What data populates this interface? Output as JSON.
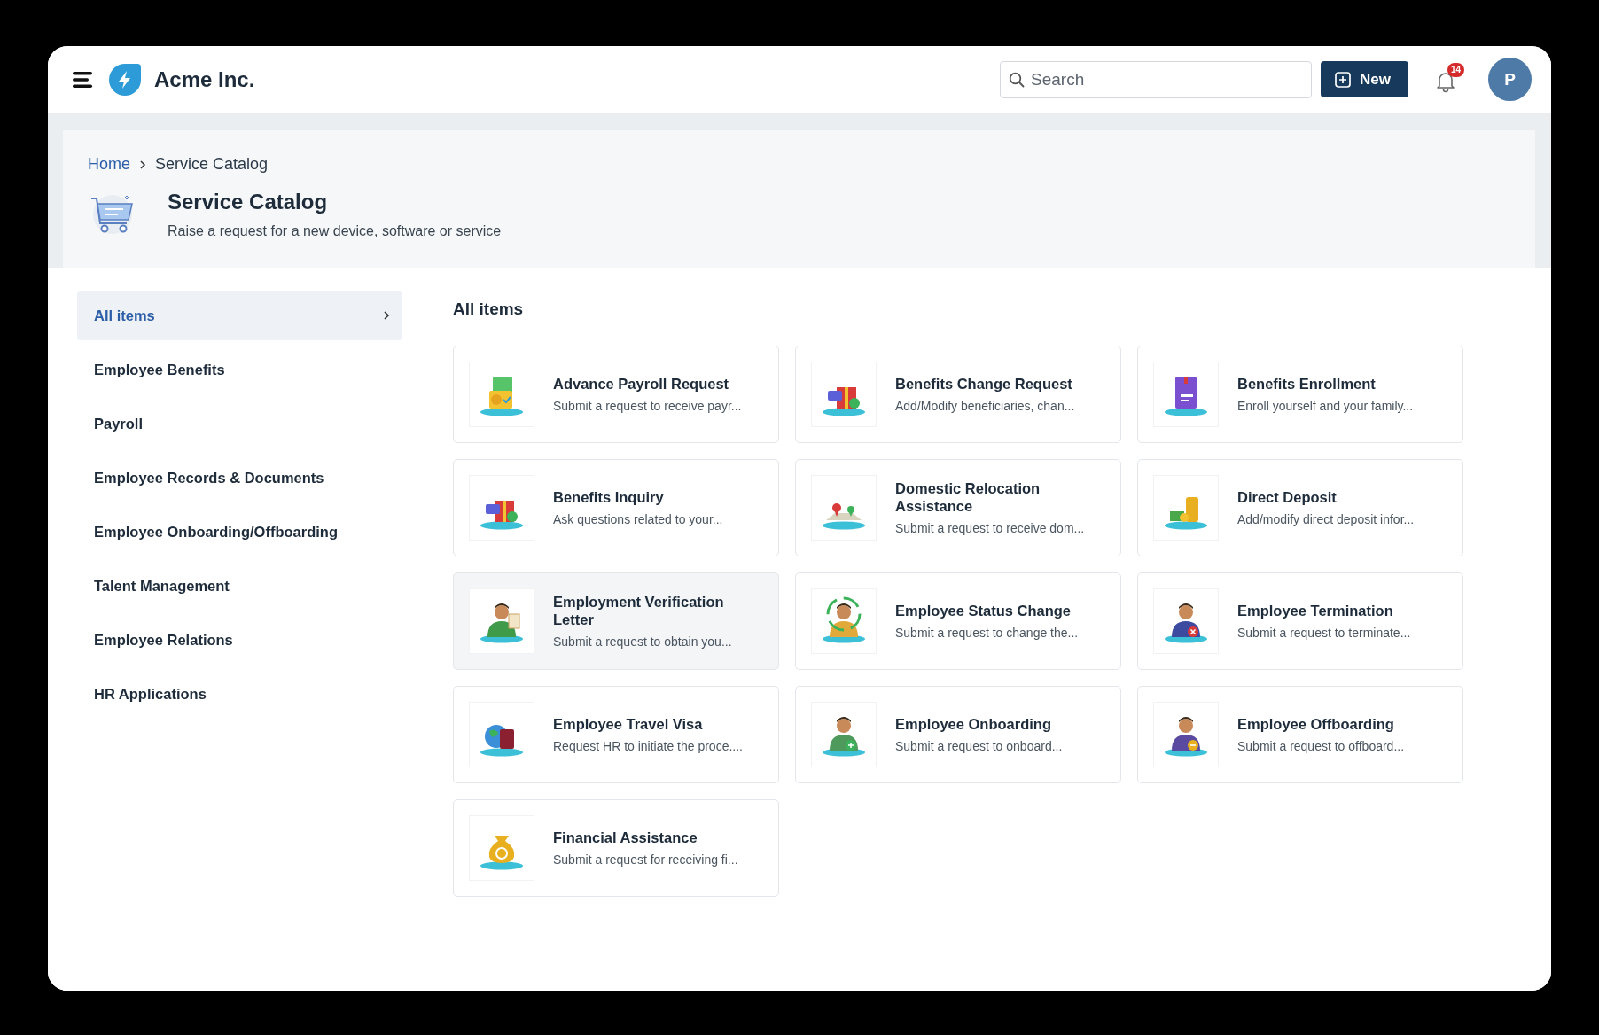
{
  "header": {
    "brand": "Acme Inc.",
    "search": {
      "placeholder": "Search"
    },
    "new_button": "New",
    "notification_count": "14",
    "avatar_initial": "P"
  },
  "breadcrumb": [
    {
      "label": "Home",
      "link": true
    },
    {
      "label": "Service Catalog",
      "link": false
    }
  ],
  "page": {
    "title": "Service Catalog",
    "subtitle": "Raise a request for a new device, software or service"
  },
  "sidebar": {
    "items": [
      {
        "label": "All items",
        "selected": true
      },
      {
        "label": "Employee Benefits",
        "selected": false
      },
      {
        "label": "Payroll",
        "selected": false
      },
      {
        "label": "Employee Records & Documents",
        "selected": false
      },
      {
        "label": "Employee Onboarding/Offboarding",
        "selected": false
      },
      {
        "label": "Talent Management",
        "selected": false
      },
      {
        "label": "Employee Relations",
        "selected": false
      },
      {
        "label": "HR Applications",
        "selected": false
      }
    ]
  },
  "catalog": {
    "heading": "All items",
    "items": [
      {
        "title": "Advance Payroll Request",
        "description": "Submit a request to receive payr...",
        "hovered": false
      },
      {
        "title": "Benefits Change Request",
        "description": "Add/Modify beneficiaries, chan...",
        "hovered": false
      },
      {
        "title": "Benefits Enrollment",
        "description": "Enroll yourself and your family...",
        "hovered": false
      },
      {
        "title": "Benefits Inquiry",
        "description": "Ask questions related to your...",
        "hovered": false
      },
      {
        "title": "Domestic Relocation Assistance",
        "description": "Submit a request to receive dom...",
        "hovered": false
      },
      {
        "title": "Direct Deposit",
        "description": "Add/modify direct deposit infor...",
        "hovered": false
      },
      {
        "title": "Employment Verification Letter",
        "description": "Submit a request to obtain you...",
        "hovered": true
      },
      {
        "title": "Employee Status Change",
        "description": "Submit a request to change the...",
        "hovered": false
      },
      {
        "title": "Employee Termination",
        "description": "Submit a request to terminate...",
        "hovered": false
      },
      {
        "title": "Employee Travel Visa",
        "description": "Request HR to initiate the proce....",
        "hovered": false
      },
      {
        "title": "Employee Onboarding",
        "description": "Submit a request to onboard...",
        "hovered": false
      },
      {
        "title": "Employee Offboarding",
        "description": "Submit a request to offboard...",
        "hovered": false
      },
      {
        "title": "Financial Assistance",
        "description": "Submit a request for receiving fi...",
        "hovered": false
      }
    ]
  }
}
